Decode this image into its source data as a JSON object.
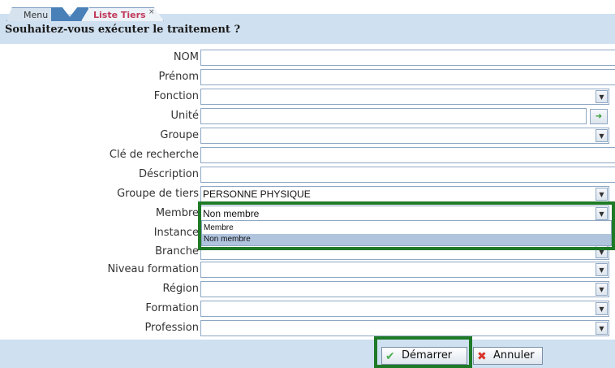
{
  "tabs": {
    "menu_label": "Menu",
    "active_label": "Liste Tiers",
    "close_glyph": "×"
  },
  "question": "Souhaitez-vous exécuter le traitement ?",
  "fields": [
    {
      "label": "NOM",
      "value": ""
    },
    {
      "label": "Prénom",
      "value": ""
    },
    {
      "label": "Fonction",
      "value": ""
    },
    {
      "label": "Unité",
      "value": ""
    },
    {
      "label": "Groupe",
      "value": ""
    },
    {
      "label": "Clé de recherche",
      "value": ""
    },
    {
      "label": "Déscription",
      "value": ""
    },
    {
      "label": "Groupe de tiers",
      "value": "PERSONNE PHYSIQUE"
    },
    {
      "label": "Membre",
      "value": "Non membre"
    },
    {
      "label": "Instance",
      "value": ""
    },
    {
      "label": "Branche",
      "value": ""
    },
    {
      "label": "Niveau formation",
      "value": ""
    },
    {
      "label": "Région",
      "value": ""
    },
    {
      "label": "Formation",
      "value": ""
    },
    {
      "label": "Profession",
      "value": ""
    }
  ],
  "membre_options": [
    "Membre",
    "Non membre"
  ],
  "membre_selected": "Non membre",
  "dropdown_glyph": "▼",
  "buttons": {
    "start": "Démarrer",
    "cancel": "Annuler"
  },
  "icons": {
    "pick": "arrow-right-icon",
    "start": "check-icon",
    "cancel": "x-icon"
  },
  "colors": {
    "bar": "#cfe0f0",
    "highlight": "#1e7a26",
    "active_tab_text": "#c0395a"
  }
}
